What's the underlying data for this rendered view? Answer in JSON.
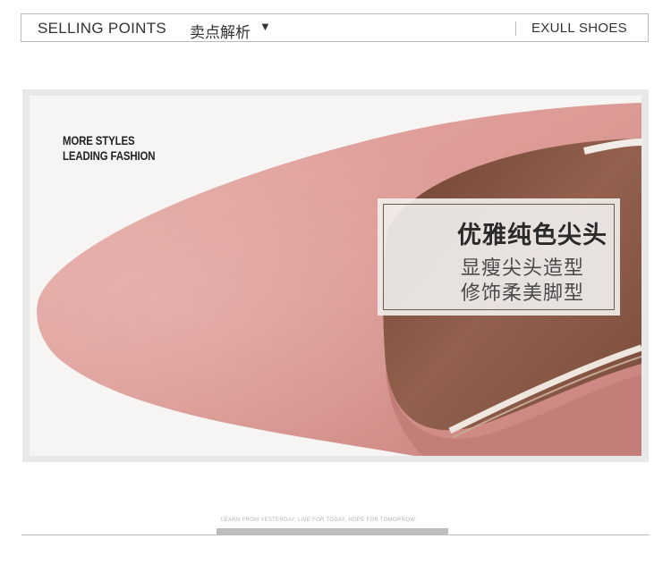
{
  "header": {
    "title": "SELLING POINTS",
    "title_cn": "卖点解析",
    "arrow": "▼",
    "brand": "EXULL SHOES"
  },
  "photo": {
    "slogan_line1": "MORE STYLES",
    "slogan_line2": "LEADING FASHION",
    "callout": {
      "title": "优雅纯色尖头",
      "line1": "显瘦尖头造型",
      "line2": "修饰柔美脚型"
    },
    "colors": {
      "suede": "#dd9b96",
      "lining": "#8a5a48",
      "background": "#f7f5f4"
    }
  },
  "footer": {
    "tagline": "LEARN FROM YESTERDAY, LIVE FOR TODAY, HOPE FOR TOMORROW."
  }
}
